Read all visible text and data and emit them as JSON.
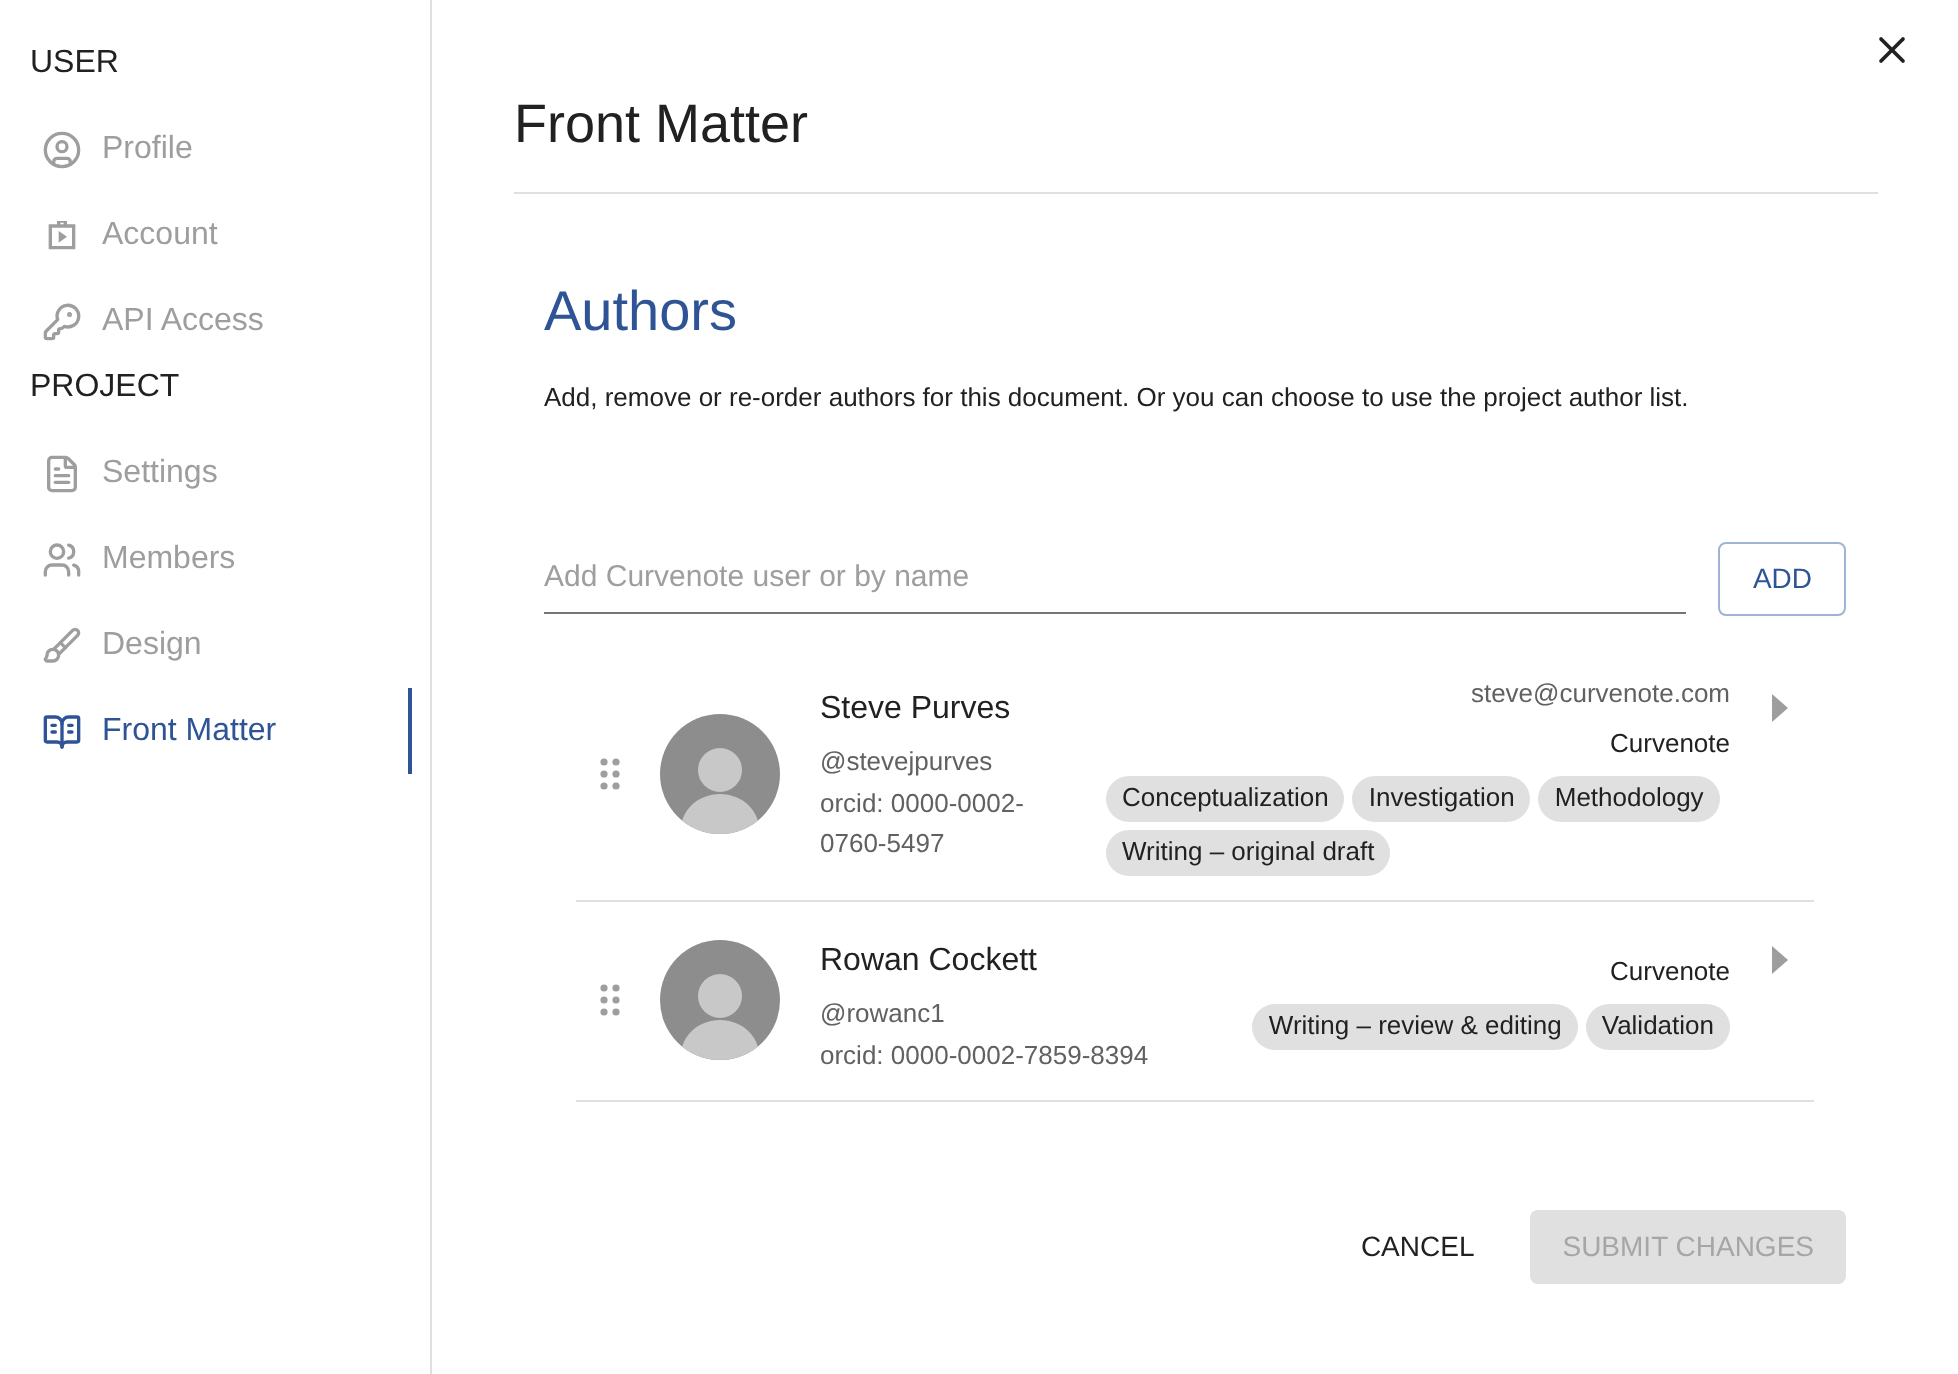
{
  "sidebar": {
    "sections": [
      {
        "heading": "USER",
        "items": [
          {
            "label": "Profile",
            "selected": false
          },
          {
            "label": "Account",
            "selected": false
          },
          {
            "label": "API Access",
            "selected": false
          }
        ]
      },
      {
        "heading": "PROJECT",
        "items": [
          {
            "label": "Settings",
            "selected": false
          },
          {
            "label": "Members",
            "selected": false
          },
          {
            "label": "Design",
            "selected": false
          },
          {
            "label": "Front Matter",
            "selected": true
          }
        ]
      }
    ]
  },
  "dialog": {
    "title": "Front Matter",
    "section_title": "Authors",
    "description": "Add, remove or re-order authors for this document. Or you can choose to use the project author list.",
    "search": {
      "placeholder": "Add Curvenote user or by name"
    },
    "add_button": "ADD",
    "authors": [
      {
        "name": "Steve Purves",
        "handle": "@stevejpurves",
        "orcid": "orcid: 0000-0002-0760-5497",
        "email": "steve@curvenote.com",
        "affiliation": "Curvenote",
        "roles": [
          "Conceptualization",
          "Investigation",
          "Methodology",
          "Writing – original draft"
        ]
      },
      {
        "name": "Rowan Cockett",
        "handle": "@rowanc1",
        "orcid": "orcid: 0000-0002-7859-8394",
        "affiliation": "Curvenote",
        "roles": [
          "Writing – review & editing",
          "Validation"
        ]
      }
    ],
    "cancel_button": "CANCEL",
    "submit_button": {
      "label": "SUBMIT CHANGES",
      "disabled": true
    }
  }
}
